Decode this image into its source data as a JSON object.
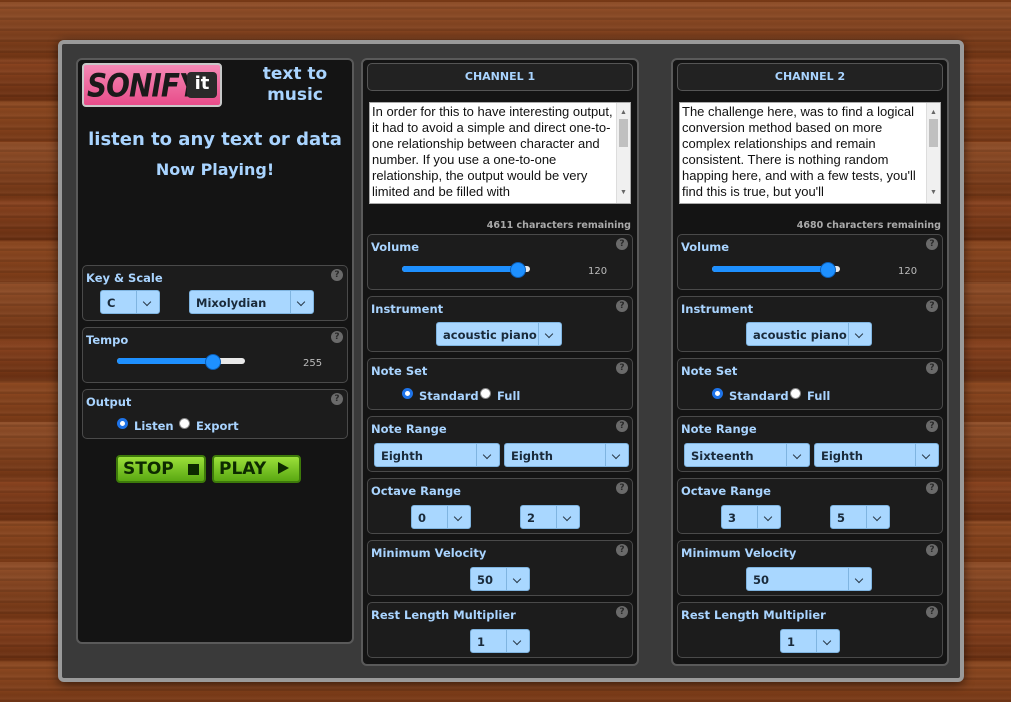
{
  "app": {
    "logo_text": "SONIFY",
    "logo_badge": "it",
    "tagline": "text to music",
    "subtitle": "listen to any text or data",
    "status": "Now Playing!"
  },
  "left": {
    "key_scale": {
      "title": "Key & Scale",
      "key": "C",
      "scale": "Mixolydian"
    },
    "tempo": {
      "title": "Tempo",
      "value": "255",
      "fraction": 0.76
    },
    "output": {
      "title": "Output",
      "listen": "Listen",
      "export": "Export",
      "selected": "Listen"
    },
    "stop_label": "STOP",
    "play_label": "PLAY",
    "help": "?"
  },
  "channels": [
    {
      "title": "CHANNEL 1",
      "text": "In order for this to have interesting output, it had to avoid a simple and direct one-to-one relationship between character and number. If you use a one-to-one relationship, the output would be very limited and be filled with",
      "remaining": "4611 characters remaining",
      "volume": {
        "title": "Volume",
        "value": "120",
        "fraction": 0.9
      },
      "instrument": {
        "title": "Instrument",
        "value": "acoustic piano"
      },
      "note_set": {
        "title": "Note Set",
        "standard": "Standard",
        "full": "Full",
        "selected": "Standard"
      },
      "note_range": {
        "title": "Note Range",
        "low": "Eighth",
        "high": "Eighth"
      },
      "octave_range": {
        "title": "Octave Range",
        "low": "0",
        "high": "2"
      },
      "min_velocity": {
        "title": "Minimum Velocity",
        "value": "50"
      },
      "rest_length": {
        "title": "Rest Length Multiplier",
        "value": "1"
      }
    },
    {
      "title": "CHANNEL 2",
      "text": "The challenge here, was to find a logical conversion method based on more complex relationships and remain consistent. There is nothing random happing here, and with a few tests, you'll find this is true, but you'll",
      "remaining": "4680 characters remaining",
      "volume": {
        "title": "Volume",
        "value": "120",
        "fraction": 0.9
      },
      "instrument": {
        "title": "Instrument",
        "value": "acoustic piano"
      },
      "note_set": {
        "title": "Note Set",
        "standard": "Standard",
        "full": "Full",
        "selected": "Standard"
      },
      "note_range": {
        "title": "Note Range",
        "low": "Sixteenth",
        "high": "Eighth"
      },
      "octave_range": {
        "title": "Octave Range",
        "low": "3",
        "high": "5"
      },
      "min_velocity": {
        "title": "Minimum Velocity",
        "value": "50"
      },
      "rest_length": {
        "title": "Rest Length Multiplier",
        "value": "1"
      }
    }
  ],
  "colors": {
    "label_blue": "#a9d4ff",
    "dropdown_bg": "#a9d7ff",
    "button_green": "#7ccf2a",
    "logo_pink": "#f0609a"
  }
}
